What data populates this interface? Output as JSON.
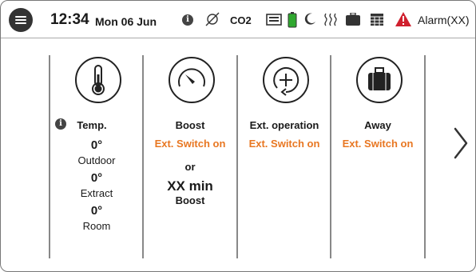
{
  "status": {
    "time": "12:34",
    "date": "Mon 06 Jun",
    "co2": "CO2",
    "alarm": "Alarm(XX)"
  },
  "columns": {
    "temp": {
      "title": "Temp.",
      "outdoor_value": "0°",
      "outdoor_label": "Outdoor",
      "extract_value": "0°",
      "extract_label": "Extract",
      "room_value": "0°",
      "room_label": "Room"
    },
    "boost": {
      "title": "Boost",
      "switch": "Ext. Switch on",
      "or": "or",
      "duration": "XX min",
      "duration_label": "Boost"
    },
    "ext_operation": {
      "title": "Ext. operation",
      "switch": "Ext. Switch on"
    },
    "away": {
      "title": "Away",
      "switch": "Ext. Switch on"
    }
  },
  "colors": {
    "accent": "#e87722",
    "alarm": "#d0202e",
    "battery": "#2fa82f"
  }
}
